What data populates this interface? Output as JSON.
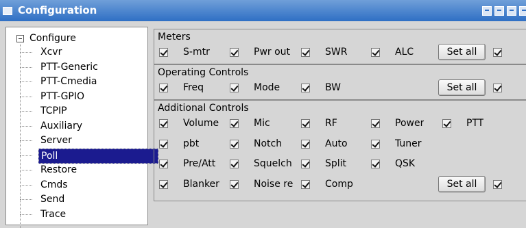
{
  "window": {
    "title": "Configuration",
    "icon": "window-icon"
  },
  "tree": {
    "root_label": "Configure",
    "items": [
      {
        "label": "Xcvr"
      },
      {
        "label": "PTT-Generic"
      },
      {
        "label": "PTT-Cmedia"
      },
      {
        "label": "PTT-GPIO"
      },
      {
        "label": "TCPIP"
      },
      {
        "label": "Auxiliary"
      },
      {
        "label": "Server"
      },
      {
        "label": "Poll",
        "selected": true
      },
      {
        "label": "Restore"
      },
      {
        "label": "Cmds"
      },
      {
        "label": "Send"
      },
      {
        "label": "Trace"
      }
    ]
  },
  "meters": {
    "title": "Meters",
    "rows": [
      [
        "S-mtr",
        "Pwr out",
        "SWR",
        "ALC"
      ]
    ],
    "set_all": "Set all"
  },
  "operating": {
    "title": "Operating Controls",
    "rows": [
      [
        "Freq",
        "Mode",
        "BW"
      ]
    ],
    "set_all": "Set all"
  },
  "additional": {
    "title": "Additional Controls",
    "rows": [
      [
        "Volume",
        "Mic",
        "RF",
        "Power",
        "PTT"
      ],
      [
        "pbt",
        "Notch",
        "Auto",
        "Tuner"
      ],
      [
        "Pre/Att",
        "Squelch",
        "Split",
        "QSK"
      ],
      [
        "Blanker",
        "Noise re",
        "Comp"
      ]
    ],
    "set_all": "Set all"
  },
  "colors": {
    "title_bar": "#2f6fc4",
    "selection": "#1b1b8f",
    "background": "#d6d6d6"
  }
}
